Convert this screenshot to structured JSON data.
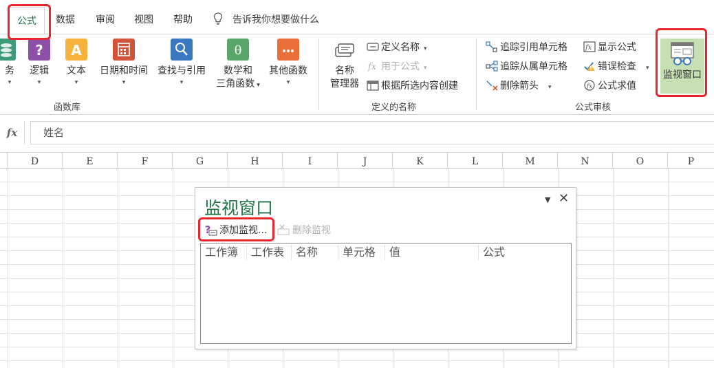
{
  "menu": {
    "tabs": [
      {
        "label": "公式",
        "active": true
      },
      {
        "label": "数据"
      },
      {
        "label": "审阅"
      },
      {
        "label": "视图"
      },
      {
        "label": "帮助"
      }
    ],
    "tell_me": "告诉我你想要做什么"
  },
  "ribbon": {
    "function_library": {
      "buttons": [
        {
          "label": "务",
          "icon": "financial-icon"
        },
        {
          "label": "逻辑",
          "icon": "logical-icon"
        },
        {
          "label": "文本",
          "icon": "text-icon"
        },
        {
          "label": "日期和时间",
          "icon": "date-time-icon"
        },
        {
          "label": "查找与引用",
          "icon": "lookup-icon"
        },
        {
          "label": "数学和",
          "label2": "三角函数",
          "icon": "math-trig-icon"
        },
        {
          "label": "其他函数",
          "icon": "more-functions-icon"
        }
      ],
      "group_label": "函数库"
    },
    "defined_names": {
      "name_manager": {
        "label": "名称",
        "label2": "管理器"
      },
      "define_name": "定义名称",
      "use_in_formula": "用于公式",
      "create_from_selection": "根据所选内容创建",
      "group_label": "定义的名称"
    },
    "formula_auditing": {
      "trace_precedents": "追踪引用单元格",
      "trace_dependents": "追踪从属单元格",
      "remove_arrows": "删除箭头",
      "show_formulas": "显示公式",
      "error_checking": "错误检查",
      "evaluate_formula": "公式求值",
      "watch_window": "监视窗口",
      "group_label": "公式审核"
    }
  },
  "formula_bar": {
    "fx": "fx",
    "content": "姓名"
  },
  "columns": [
    "D",
    "E",
    "F",
    "G",
    "H",
    "I",
    "J",
    "K",
    "L",
    "M",
    "N",
    "O",
    "P"
  ],
  "watch_window": {
    "title": "监视窗口",
    "add_watch": "添加监视...",
    "delete_watch": "删除监视",
    "table_columns": [
      "工作簿",
      "工作表",
      "名称",
      "单元格",
      "值",
      "公式"
    ]
  },
  "colors": {
    "accent": "#217346",
    "highlight": "#e8262c",
    "watch_btn_bg": "#c6e0b4"
  }
}
